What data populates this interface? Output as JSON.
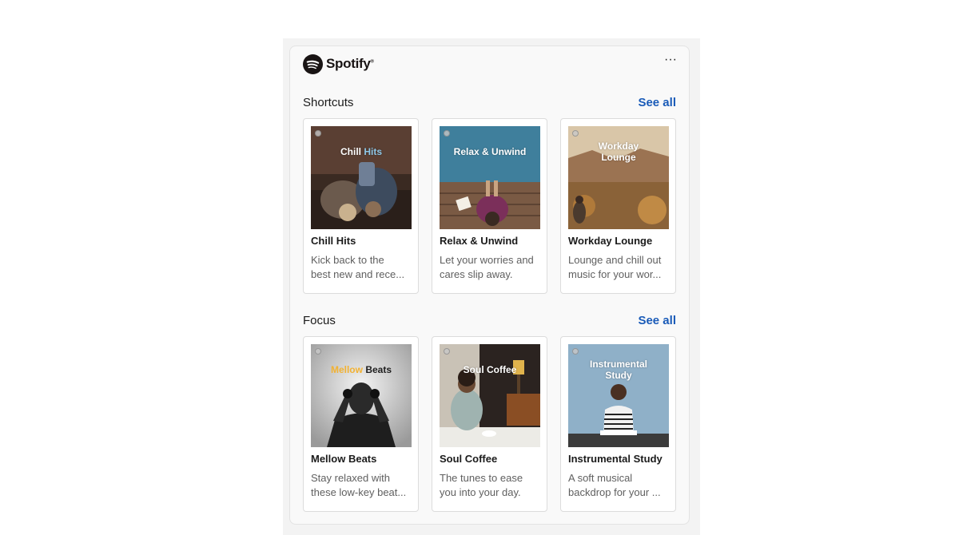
{
  "app": {
    "brand": "Spotify",
    "brand_mark": "®",
    "more_label": "···"
  },
  "sections": [
    {
      "title": "Shortcuts",
      "see_all": "See all",
      "cards": [
        {
          "cover_text_a": "Chill ",
          "cover_text_b": "Hits",
          "title": "Chill Hits",
          "desc_line1": "Kick back to the",
          "desc_line2": "best new and rece..."
        },
        {
          "cover_text_a": "Relax & Unwind",
          "cover_text_b": "",
          "title": "Relax & Unwind",
          "desc_line1": "Let your worries and",
          "desc_line2": "cares slip away."
        },
        {
          "cover_text_a": "Workday",
          "cover_text_b": "Lounge",
          "title": "Workday Lounge",
          "desc_line1": "Lounge and chill out",
          "desc_line2": "music for your wor..."
        }
      ]
    },
    {
      "title": "Focus",
      "see_all": "See all",
      "cards": [
        {
          "cover_text_a": "Mellow",
          "cover_text_b": " Beats",
          "title": "Mellow  Beats",
          "desc_line1": "Stay relaxed with",
          "desc_line2": "these low-key beat..."
        },
        {
          "cover_text_a": "Soul Coffee",
          "cover_text_b": "",
          "title": "Soul Coffee",
          "desc_line1": "The tunes to ease",
          "desc_line2": "you into your day."
        },
        {
          "cover_text_a": "Instrumental",
          "cover_text_b": "Study",
          "title": "Instrumental Study",
          "desc_line1": "A soft musical",
          "desc_line2": "backdrop for your ..."
        }
      ]
    }
  ],
  "colors": {
    "link": "#1a5bb8",
    "chill_hits_accent": "#8ec8e8",
    "mellow_accent": "#f2b233"
  },
  "icons": {
    "logo": "spotify-logo-icon",
    "more": "more-options-icon"
  }
}
